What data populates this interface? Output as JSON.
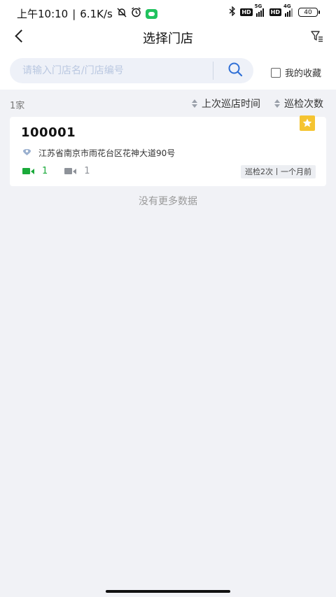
{
  "status_bar": {
    "time": "上午10:10",
    "separator": "|",
    "speed": "6.1K/s",
    "net1": "5G",
    "net2": "4G",
    "hd": "HD",
    "battery": "40"
  },
  "nav": {
    "title": "选择门店"
  },
  "search": {
    "placeholder": "请输入门店名/门店编号",
    "value": "",
    "favorites_label": "我的收藏"
  },
  "list_header": {
    "count": "1家",
    "sort_last_patrol": "上次巡店时间",
    "sort_inspect_count": "巡检次数"
  },
  "stores": [
    {
      "code": "100001",
      "address": "江苏省南京市雨花台区花神大道90号",
      "online_cameras": "1",
      "offline_cameras": "1",
      "inspection_summary": "巡检2次丨一个月前",
      "favorited": true
    }
  ],
  "no_more": "没有更多数据",
  "colors": {
    "online": "#1aaa3a",
    "offline": "#8e9299",
    "favorite_star": "#f5c431",
    "search_icon": "#2f6fd6"
  }
}
